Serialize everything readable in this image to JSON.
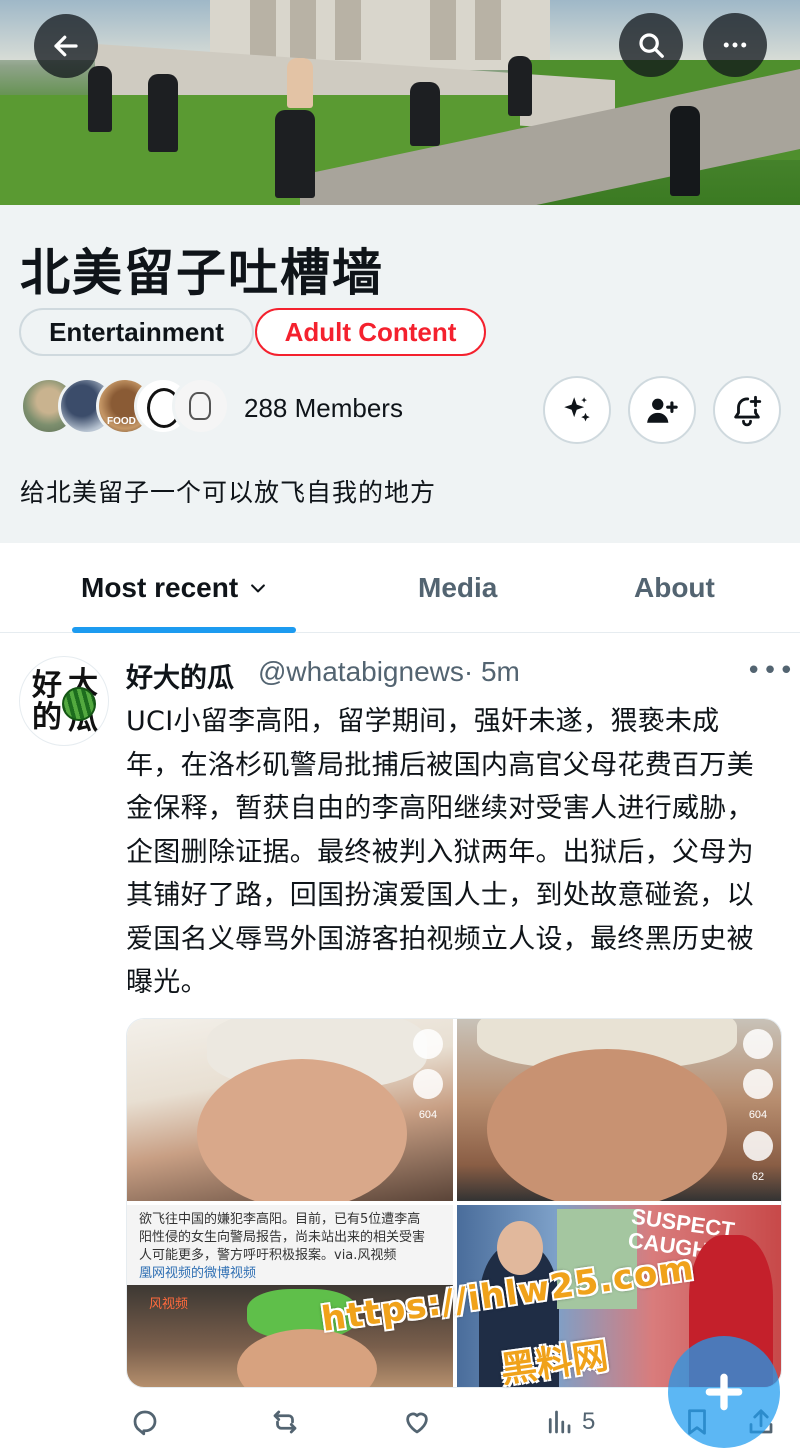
{
  "header": {
    "title": "北美留子吐槽墙",
    "back_icon": "arrow-left-icon",
    "search_icon": "search-icon",
    "more_icon": "more-horizontal-icon"
  },
  "tags": [
    {
      "label": "Entertainment",
      "color": "#0f1419"
    },
    {
      "label": "Adult Content",
      "color": "#f4212e"
    }
  ],
  "members": {
    "label": "288 Members",
    "avatar_food_text": "FOOD"
  },
  "action_buttons": [
    "sparkle-icon",
    "person-add-icon",
    "bell-plus-icon"
  ],
  "description": "给北美留子一个可以放飞自我的地方",
  "tabs": {
    "most_recent": "Most recent",
    "media": "Media",
    "about": "About",
    "accent": "#1d9bf0"
  },
  "post": {
    "avatar_chars": [
      "好",
      "大",
      "的",
      "瓜"
    ],
    "name": "好大的瓜",
    "handle": "@whatabignews",
    "time": "· 5m",
    "text": "UCI小留李高阳，留学期间，强奸未遂，猥亵未成年，在洛杉矶警局批捕后被国内高官父母花费百万美金保释，暂获自由的李高阳继续对受害人进行威胁，企图删除证据。最终被判入狱两年。出狱后，父母为其铺好了路，回国扮演爱国人士，到处故意碰瓷，以爱国名义辱骂外国游客拍视频立人设，最终黑历史被曝光。",
    "media": {
      "cell1_count": "604",
      "cell2_count_likes": "604",
      "cell2_count_comments": "62",
      "cell3_caption": "欲飞往中国的嫌犯李高阳。目前，已有5位遭李高阳性侵的女生向警局报告，尚未站出来的相关受害人可能更多，警方呼吁积极报案。via.风视频",
      "cell3_link": "凰网视频的微博视频",
      "cell3_watermark": "风视频",
      "cell4_caption": "SUSPECT CAUGHT"
    },
    "actions": {
      "reply_icon": "reply-icon",
      "retweet_icon": "retweet-icon",
      "like_icon": "heart-icon",
      "views_icon": "views-chart-icon",
      "views_count": "5",
      "bookmark_icon": "bookmark-icon",
      "share_icon": "share-icon"
    }
  },
  "watermark": {
    "url": "https://ihlw25.com",
    "name": "黑料网"
  },
  "fab_icon": "plus-icon"
}
